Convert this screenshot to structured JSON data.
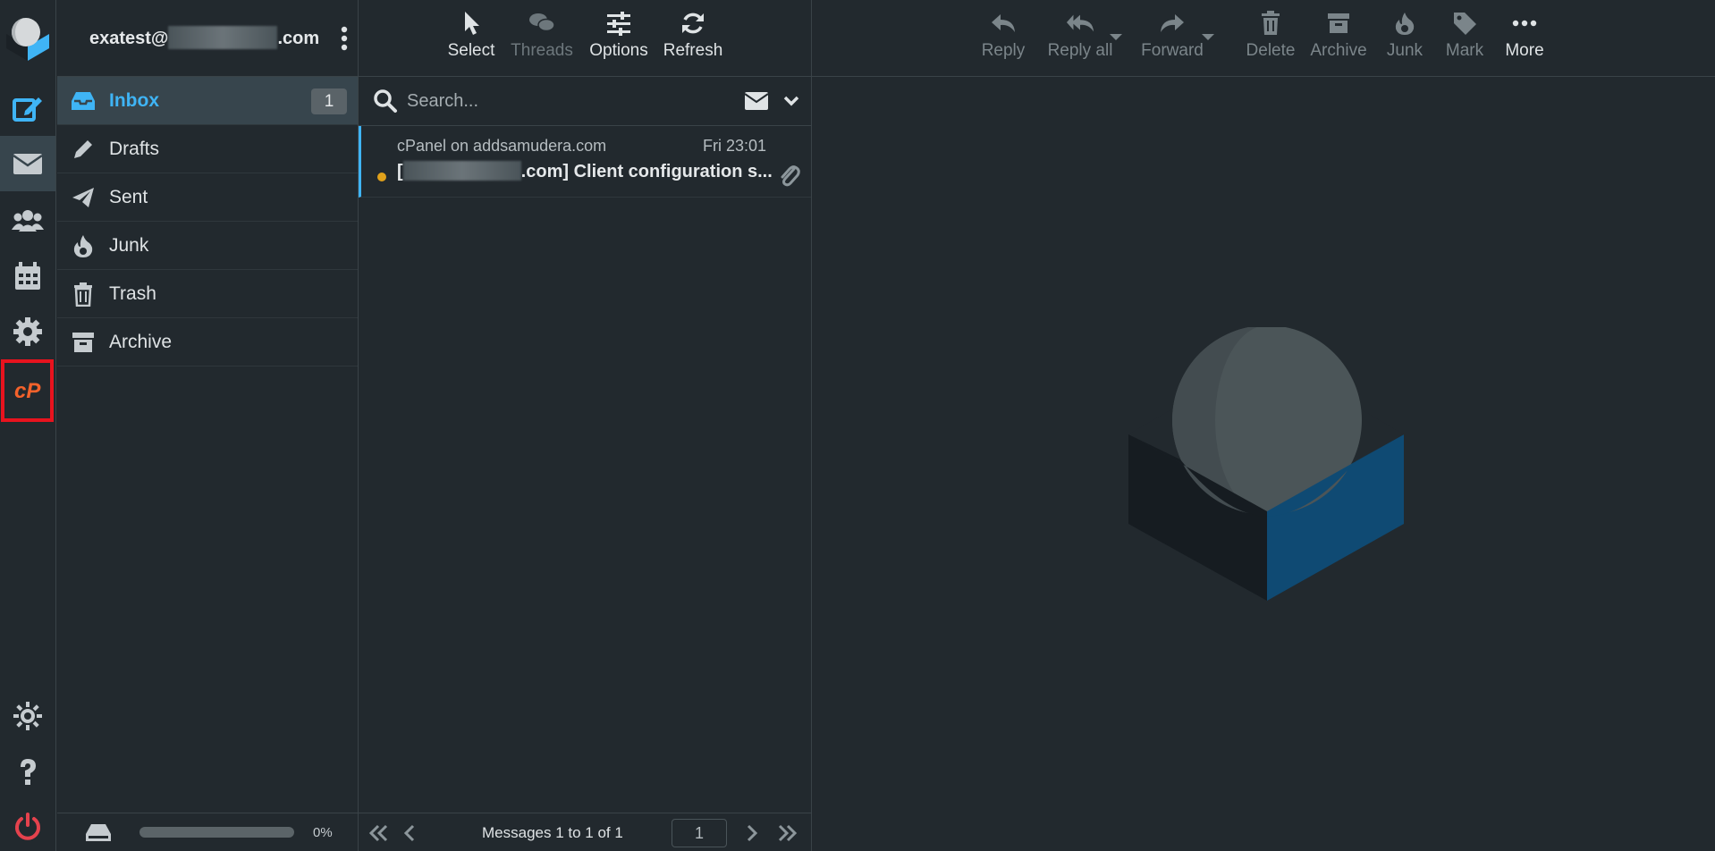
{
  "account": {
    "name_prefix": "exatest@",
    "name_suffix": ".com"
  },
  "folders": [
    {
      "label": "Inbox",
      "icon": "inbox-icon",
      "unread": "1"
    },
    {
      "label": "Drafts",
      "icon": "pencil-icon"
    },
    {
      "label": "Sent",
      "icon": "paper-plane-icon"
    },
    {
      "label": "Junk",
      "icon": "flame-icon"
    },
    {
      "label": "Trash",
      "icon": "trash-icon"
    },
    {
      "label": "Archive",
      "icon": "archive-box-icon"
    }
  ],
  "quota": {
    "percent_label": "0%",
    "fraction": 0.0
  },
  "list_toolbar": {
    "select": "Select",
    "threads": "Threads",
    "options": "Options",
    "refresh": "Refresh"
  },
  "search": {
    "placeholder": "Search..."
  },
  "messages": [
    {
      "from": "cPanel on addsamudera.com",
      "date": "Fri 23:01",
      "subject_prefix": "[",
      "subject_suffix": ".com] Client configuration s...",
      "unread": true,
      "has_attachment": true
    }
  ],
  "pager": {
    "text": "Messages 1 to 1 of 1",
    "page": "1"
  },
  "message_toolbar": {
    "reply": "Reply",
    "reply_all": "Reply all",
    "forward": "Forward",
    "delete": "Delete",
    "archive": "Archive",
    "junk": "Junk",
    "mark": "Mark",
    "more": "More"
  },
  "colors": {
    "background": "#22292e",
    "accent": "#3fb4f5",
    "highlight_red": "#e8131e",
    "cpanel_orange": "#f4622b",
    "unread_dot": "#e0a11b"
  }
}
